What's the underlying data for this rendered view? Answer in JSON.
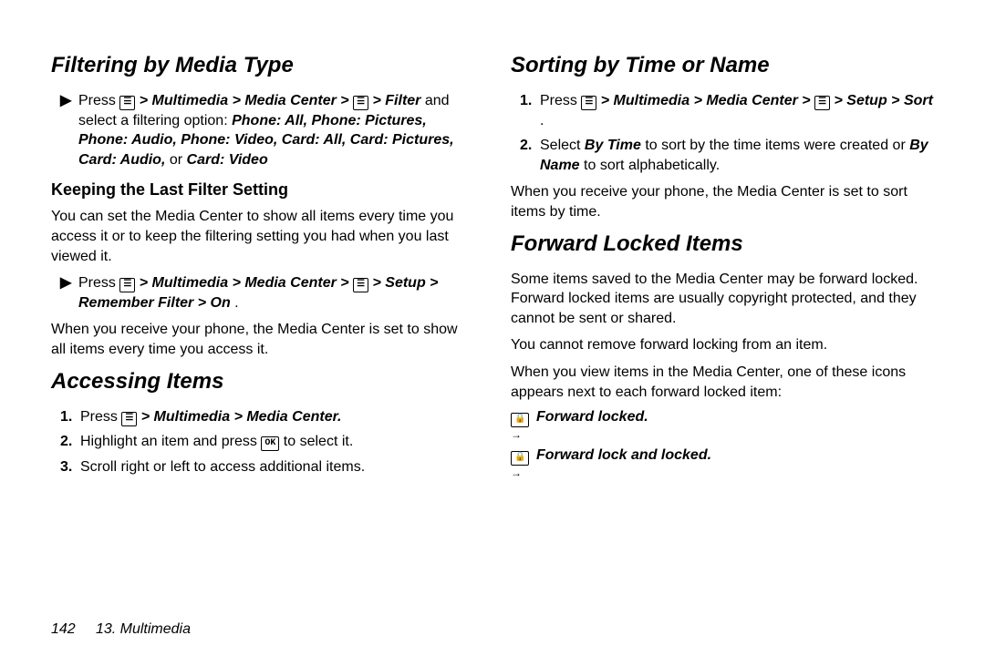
{
  "footer": {
    "page": "142",
    "chapter": "13. Multimedia"
  },
  "col1": {
    "h_filter": "Filtering by Media Type",
    "filter_step_press": "Press ",
    "filter_step_path": " > Multimedia > Media Center > ",
    "filter_step_end": " > Filter",
    "filter_step_cont1": " and select a filtering option: ",
    "filter_opts": "Phone: All, Phone: Pictures, Phone: Audio, Phone: Video, Card: All, Card: Pictures, Card: Audio,",
    "filter_or": " or ",
    "filter_last_opt": "Card: Video",
    "h_keep": "Keeping the Last Filter Setting",
    "keep_body": "You can set the Media Center to show all items every time you access it or to keep the filtering setting you had when you last viewed it.",
    "keep_step_press": "Press ",
    "keep_step_path1": " > Multimedia > Media Center > ",
    "keep_step_path2": " > Setup > Remember Filter > On",
    "keep_period": ".",
    "keep_after": "When you receive your phone, the Media Center is set to show all items every time you access it.",
    "h_access": "Accessing Items",
    "access_1_press": "Press ",
    "access_1_path": " > Multimedia > Media Center.",
    "access_2a": "Highlight an item and press ",
    "access_2b": " to select it.",
    "access_3": "Scroll right or left to access additional items."
  },
  "col2": {
    "h_sort": "Sorting by Time or Name",
    "sort_1_press": "Press ",
    "sort_1_path1": " > Multimedia > Media Center > ",
    "sort_1_path2": " > Setup > Sort",
    "sort_1_period": ".",
    "sort_2a": "Select ",
    "sort_2_bytime": "By Time",
    "sort_2b": " to sort by the time items were created or ",
    "sort_2_byname": "By Name",
    "sort_2c": " to sort alphabetically.",
    "sort_after": "When you receive your phone, the Media Center is set to sort items by time.",
    "h_fwd": "Forward Locked Items",
    "fwd_p1": "Some items saved to the Media Center may be forward locked. Forward locked items are usually copyright protected, and they cannot be sent or shared.",
    "fwd_p2": "You cannot remove forward locking from an item.",
    "fwd_p3": "When you view items in the Media Center, one of these icons appears next to each forward locked item:",
    "fwd_icon1_label": "Forward locked.",
    "fwd_icon2_label": "Forward lock and locked."
  },
  "glyphs": {
    "menu": "☰",
    "ok": "OK",
    "fwd1": "🔒",
    "fwd2": "🔒"
  }
}
